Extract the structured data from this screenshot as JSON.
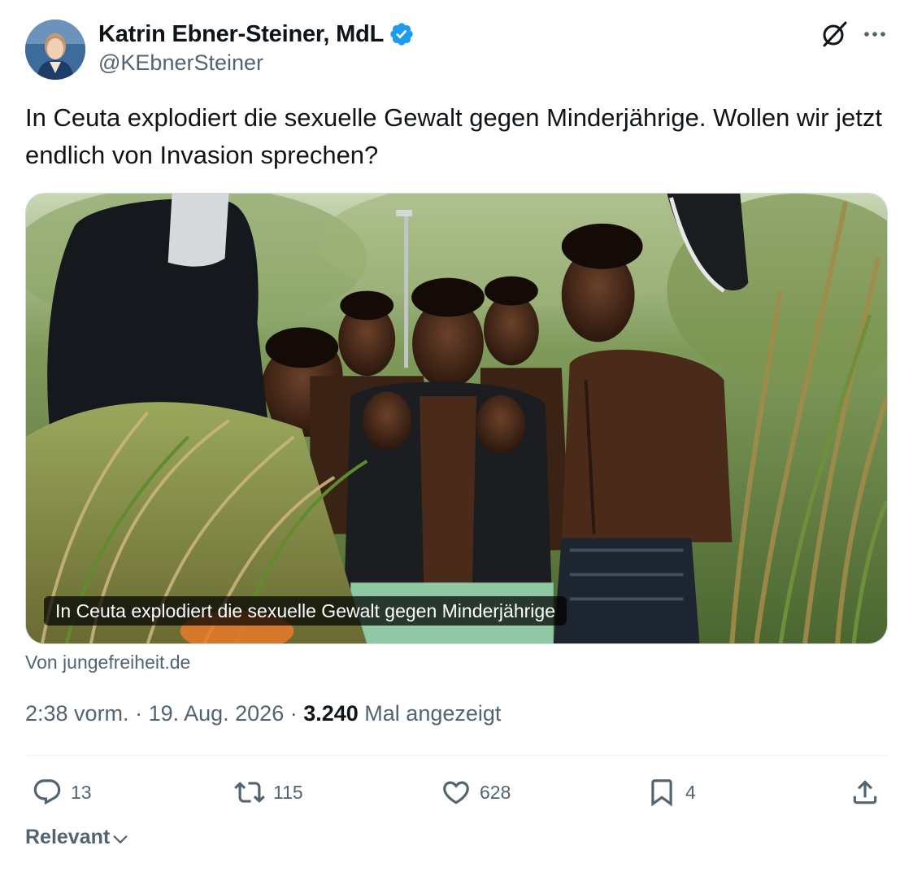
{
  "author": {
    "display_name": "Katrin Ebner-Steiner, MdL",
    "handle": "@KEbnerSteiner",
    "verified": true,
    "verified_color": "#1d9bf0"
  },
  "icons": {
    "grok": "grok-icon",
    "more": "more-icon",
    "reply": "reply-icon",
    "retweet": "retweet-icon",
    "like": "heart-icon",
    "bookmark": "bookmark-icon",
    "share": "share-icon",
    "chevron": "chevron-down-icon"
  },
  "tweet": {
    "text": "In Ceuta explodiert die sexuelle Gewalt gegen Minderjährige. Wollen wir jetzt endlich von Invasion sprechen?"
  },
  "media": {
    "caption": "In Ceuta explodiert die sexuelle Gewalt gegen Minderjährige",
    "source": "Von jungefreiheit.de"
  },
  "meta": {
    "time": "2:38 vorm.",
    "sep1": " · ",
    "date": "19. Aug. 2026",
    "sep2": " · ",
    "views": "3.240",
    "views_label": " Mal angezeigt"
  },
  "actions": {
    "replies": "13",
    "retweets": "115",
    "likes": "628",
    "bookmarks": "4"
  },
  "sort": {
    "label": "Relevant"
  },
  "colors": {
    "text_primary": "#0f1419",
    "text_secondary": "#536471",
    "divider": "#eff3f4"
  }
}
